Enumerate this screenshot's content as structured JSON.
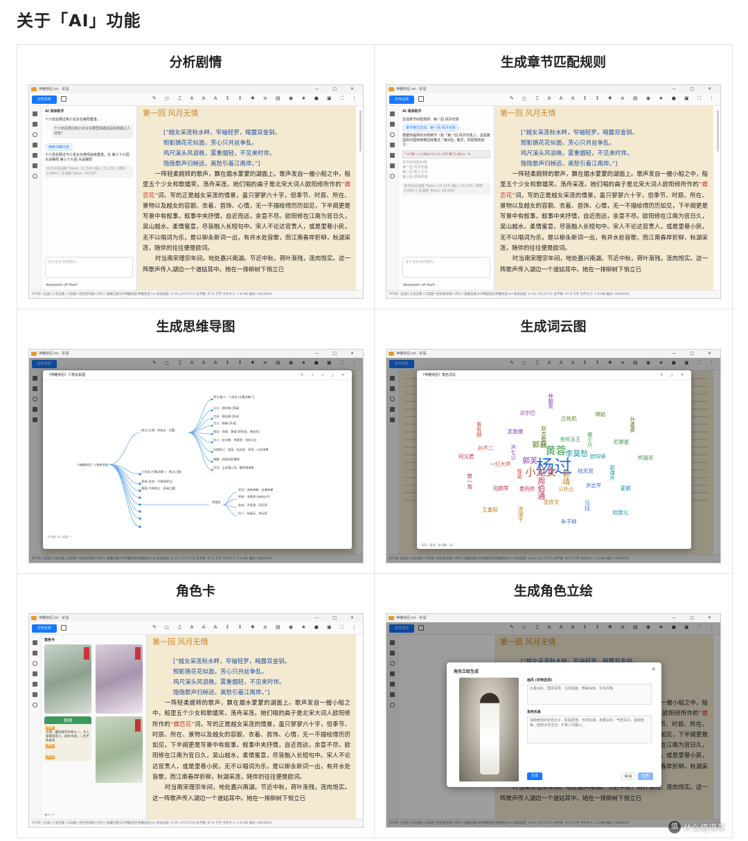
{
  "heading": "关于「AI」功能",
  "app": {
    "window_title": "神雕侠侣.txt - 彩蛋",
    "open_file": "打开文件",
    "chapter_title": "第一回  风月无情",
    "poem": [
      "[“越女采莲秋水畔，窄袖轻罗，暗露双金钏。",
      "照影摘花花似面，芳心只共丝争乱。",
      "鸡尺溪头风浪晚，雾重烟轻，不见来时伴。",
      "隐隐歌声归棹远，离愁引着江南岸。”]"
    ],
    "prose_before": "一阵轻柔婉转的歌声，飘在烟水蒙蒙的湖面上。歌声发自一艘小船之中，船里五个少女和歌嬉笑，荡舟采莲。她们唱的曲子是北宋大词人欧阳修所作的",
    "prose_red": "“蝶恋花”",
    "prose_after": "词，写的正是越女采莲的情景，虽只寥寥六十字，但季节、时辰、所在、景物以及越女的容貌、衣着、首饰、心情，无一不描绘得历历如见，下半阕更是写景中有叙事，叙事中夹抒情，自近而远，余意不尽。欧阳修在江南为官日久，吴山越水，柔情蜜意，尽皆融入长短句中。宋人不论达官贵人，或是里巷小民，无不以唱词为乐，是以柳永新词一出，有井水处皆歌，而江南春岸折柳，秋湖采莲，随伴的往往便是欧词。",
    "prose_2": "时当南宋理宗年间，地处嘉兴南湖。节近中秋，荷叶渐残，莲肉饱实。这一阵歌声传入湖边一个道姑耳中。她在一排柳树下悄立已",
    "status": "RTF阅: [全册] 小说合集 (三联版+世纪新修版+评论) \\金庸全集\\05神雕侠侣\\神雕侠侣.txt    阅读进度: 0.3% (25/7273)    总字数: 97.6 万字    文件大小: 1.8 MB    编码: GB18030"
  },
  "cells": [
    {
      "title": "分析剧情",
      "panel_title": "AI 阅读助手",
      "conv_title": "十六年后杨过和小龙女在襄阳重逢...",
      "user_question": "十六年后杨过和小龙女在哪里相遇这段情感最让人动容？",
      "chip": "搜索书籍内容",
      "answer": "十六年后杨过与小龙女在绝情谷底重逢，在 第三十九回 大战襄阳 第三十九回 大战襄阳",
      "meta": "本次对话消耗 Token: 11,340 (输入 11,220 / 缓存 5,880) | 总消耗 Token: 40,007",
      "input_placeholder": "关于这本书你想问...",
      "model": "deepseek-v4-flash"
    },
    {
      "title": "生成章节匹配规则",
      "panel_title": "AI 阅读助手",
      "conv_title": "生成章节匹配规则：第一回 风月无情",
      "user_question": "章节格式生成：第一回 风月无情",
      "answer": "根据你提供的示例章节（如「第一回 风月无情」），这是典型的中国传统章回体格式「第X回」格式，匹配规则如下：",
      "rule": "^\\s*第[一二三四五六七八九十百千零〇]+回\\s+.*$",
      "rule_intro": "本书可匹配示例：",
      "matches": [
        "第一回 风月无情",
        "第二回 故人之子",
        "第三回 求师终南"
      ],
      "meta": "本次对话消耗 Token: 13,416 (输入 13,214 / 缓存 5,840) | 总消耗 Token: 40,009",
      "input_placeholder": "关于这本书你想问...",
      "model": "deepseek-v4-flash"
    },
    {
      "title": "生成思维导图",
      "modal_title": "《神雕侠侣》人物关系图",
      "root": "《神雕侠侣》人物关系图",
      "branch_a": "杨过 (主角 · 终南派 · 古墓)",
      "branch_b": "小龙女 (古墓派掌门 · 杨过之妻)",
      "branch_c": "郭靖 (北侠 · 丐帮前帮主)",
      "branch_d": "黄蓉 (丐帮帮主 · 郭靖之妻)",
      "branch_e": "李莫愁",
      "leaves_a": [
        "师父/爱人：小龙女 (古墓派掌门)",
        "义父：欧阳锋 (西毒)",
        "生母：穆念慈 (养母)",
        "生父：杨康 (早逝)",
        "朋友：郭靖、黄蓉 (郭伯伯、黄伯母)",
        "仇人：赵志敬、李莫愁、金轮法王",
        "红颜知己：程英、陆无双、郭芙、公孙绿萼",
        "神雕：独孤求败遗物",
        "武功：玉女素心剑、黯然销魂掌"
      ],
      "leaves_e": [
        "武功：赤练神掌、五毒神掌",
        "师妹：李莫愁 (赤练仙子)",
        "徒弟：洪凌波、陆无双",
        "仇人：陆展元、何沅君"
      ],
      "status": "节点数: 63, 层级: 7"
    },
    {
      "title": "生成词云图",
      "modal_title": "《神雕侠侣》角色词云",
      "words": [
        "杨过",
        "小龙女",
        "黄蓉",
        "郭靖",
        "郭芙",
        "李莫愁",
        "周伯通",
        "郭襄",
        "陆无双",
        "程英",
        "金轮法王",
        "公孙止",
        "洪七公",
        "欧阳锋",
        "黄药师",
        "赵志敬",
        "尹志平",
        "一灯大师",
        "裘千尺",
        "武修文",
        "武敦儒",
        "耶律齐",
        "完颜萍",
        "丘处机",
        "马钰",
        "孙不二",
        "尼摩星",
        "潇湘子",
        "达尔巴",
        "霍都",
        "樊一翁",
        "瑛姑",
        "朱子柳",
        "鲁有脚",
        "柯镇恶",
        "王重阳",
        "林朝英",
        "陆展元",
        "何沅君",
        "孙婆婆"
      ],
      "status": "词云: 角色, 总词数: 58"
    },
    {
      "title": "角色卡",
      "panel_title": "角色卡",
      "card_name": "郭靖",
      "card_tag1": "性格",
      "card_text1": "大侠、襄阳城守护者之一，为人厚重而忠义，质朴木讷，一生不改本色",
      "card_tag2": "关系",
      "card_tag3": "武功",
      "status": "共 5 个"
    },
    {
      "title": "生成角色立绘",
      "dialog_title": "角色立绘生成",
      "field1": "画风 (非特选项)",
      "field1_value": "水墨淡彩、国风写意、古风插画、唯美仙侠、写实风格",
      "field2": "角色形象",
      "field2_value": "清丽绝俗的年轻女子，肌肤胜雪，长发如瀑，身着白衣，气质清冷，容颜绝美，面容冰清玉洁，不食人间烟火。",
      "gen": "生成",
      "cancel": "取消",
      "ok": "应用",
      "watermark": "什么值得买"
    }
  ]
}
